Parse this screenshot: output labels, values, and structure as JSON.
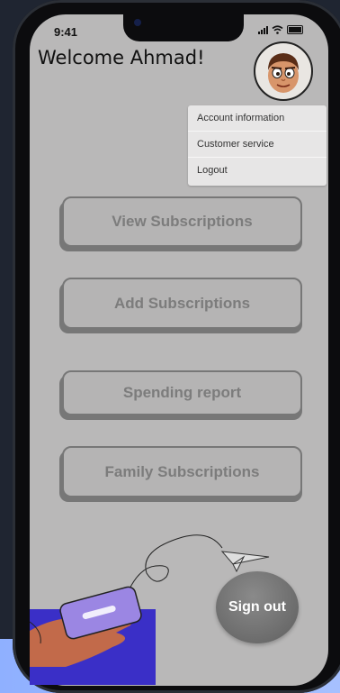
{
  "status_bar": {
    "time": "9:41"
  },
  "header": {
    "welcome": "Welcome Ahmad!"
  },
  "account_menu": {
    "items": [
      "Account information",
      "Customer service",
      "Logout"
    ]
  },
  "actions": {
    "view": "View Subscriptions",
    "add": "Add Subscriptions",
    "report": "Spending report",
    "family": "Family Subscriptions"
  },
  "sign_out": "Sign out",
  "colors": {
    "screen_bg": "#b9b8b8",
    "button_bg": "#b5b4b4",
    "button_text": "#7c7c7c",
    "illustration_blue": "#3a2fc7",
    "phone_purple": "#9b86e3"
  }
}
